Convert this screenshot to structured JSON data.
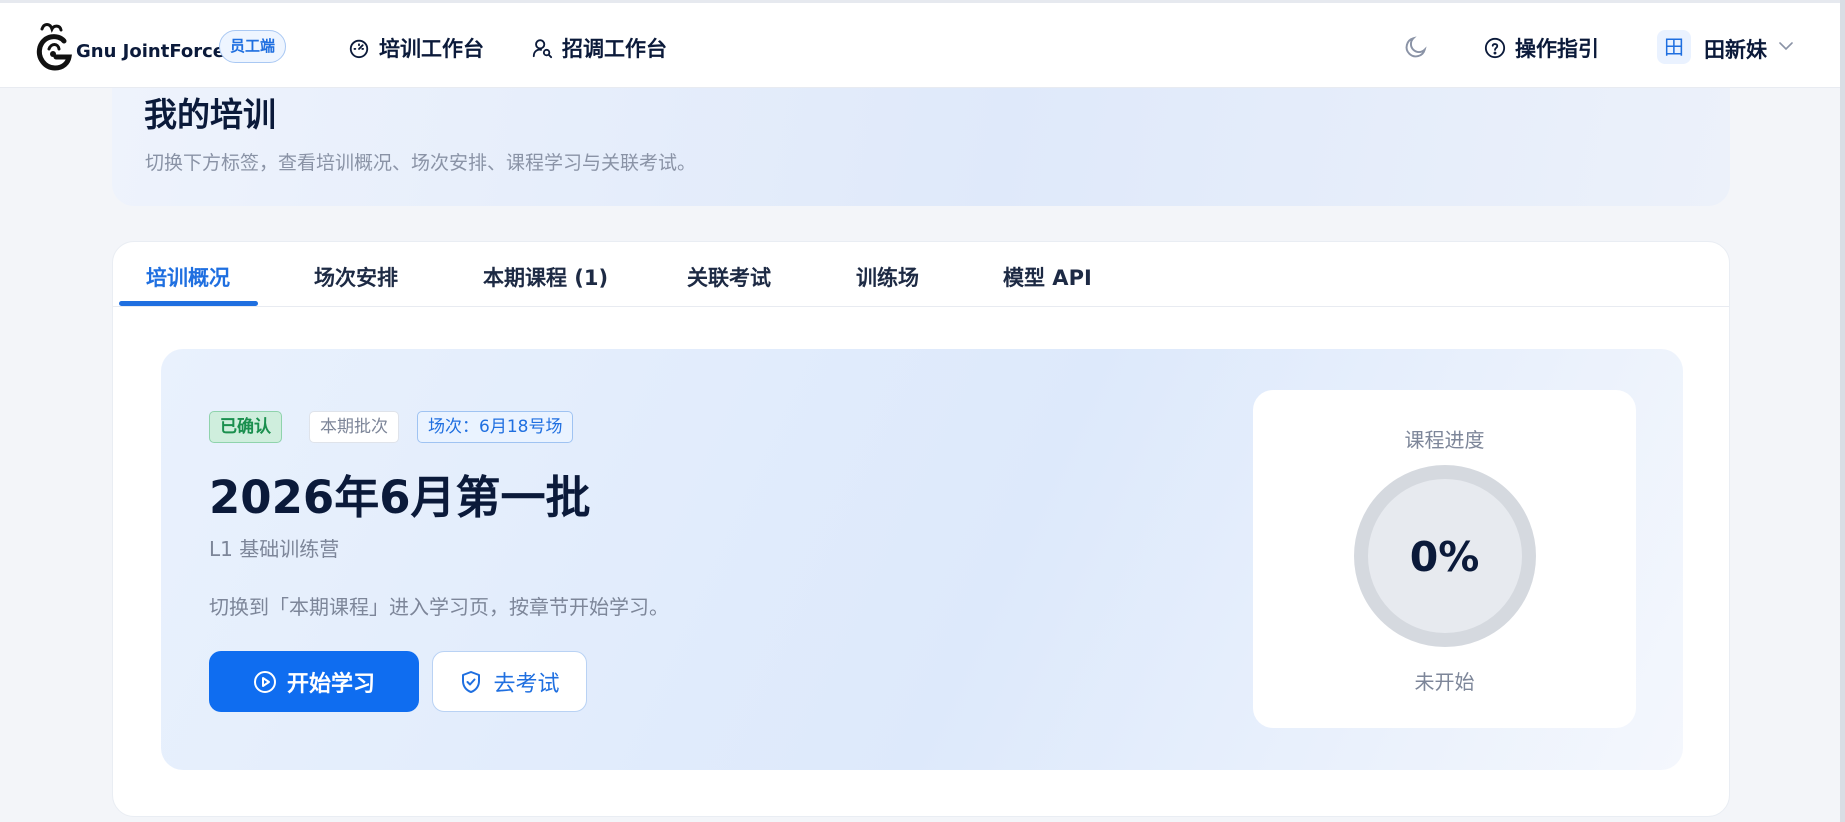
{
  "header": {
    "brand": "Gnu JointForce",
    "role_badge": "员工端",
    "nav": [
      {
        "label": "培训工作台",
        "icon": "dashboard-icon"
      },
      {
        "label": "招调工作台",
        "icon": "user-search-icon"
      }
    ],
    "theme_icon": "moon-icon",
    "guide_label": "操作指引",
    "user": {
      "avatar_text": "田",
      "name": "田新妹"
    }
  },
  "hero": {
    "title": "我的培训",
    "subtitle": "切换下方标签，查看培训概况、场次安排、课程学习与关联考试。"
  },
  "tabs": [
    {
      "label": "培训概况",
      "active": true
    },
    {
      "label": "场次安排",
      "active": false
    },
    {
      "label": "本期课程 (1)",
      "active": false
    },
    {
      "label": "关联考试",
      "active": false
    },
    {
      "label": "训练场",
      "active": false
    },
    {
      "label": "模型 API",
      "active": false
    }
  ],
  "training": {
    "badges": {
      "confirmed": "已确认",
      "batch": "本期批次",
      "session": "场次：6月18号场"
    },
    "title": "2026年6月第一批",
    "subtitle": "L1 基础训练营",
    "hint": "切换到「本期课程」进入学习页，按章节开始学习。",
    "start_label": "开始学习",
    "exam_label": "去考试"
  },
  "progress": {
    "label": "课程进度",
    "value": "0%",
    "fraction": 0,
    "status": "未开始"
  },
  "colors": {
    "accent": "#1f6fe0",
    "primary_button": "#0f6df0",
    "success": "#1a8f4e",
    "text_dark": "#0b1a3a",
    "text_muted": "#7d8699"
  }
}
